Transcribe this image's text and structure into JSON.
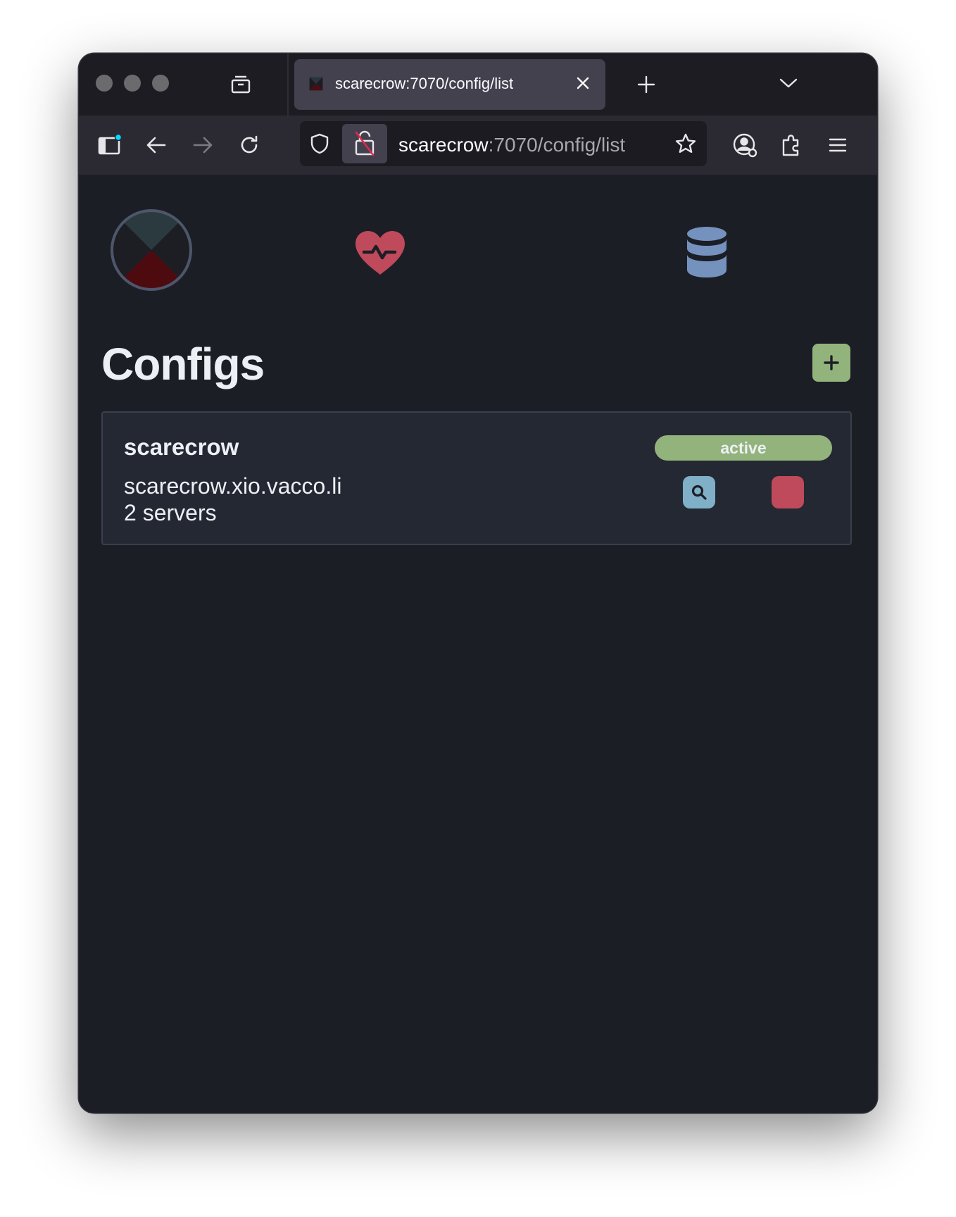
{
  "browser": {
    "tab": {
      "title": "scarecrow:7070/config/list"
    },
    "url": {
      "host": "scarecrow",
      "path": ":7070/config/list"
    }
  },
  "icons": {
    "logo": "scarecrow-logo-icon",
    "health": "heart-pulse-icon",
    "storage": "database-icon",
    "add": "plus-icon",
    "view": "search-icon",
    "delete": "delete-icon"
  },
  "colors": {
    "page_bg": "#1c1e26",
    "card_bg": "#242833",
    "accent_green": "#93b37c",
    "accent_blue": "#7fb0c8",
    "accent_red": "#bf4a5b",
    "heart": "#bf4a5b",
    "database": "#7592bf"
  },
  "page": {
    "title": "Configs"
  },
  "configs": [
    {
      "name": "scarecrow",
      "host": "scarecrow.xio.vacco.li",
      "servers": "2 servers",
      "status": "active"
    }
  ]
}
